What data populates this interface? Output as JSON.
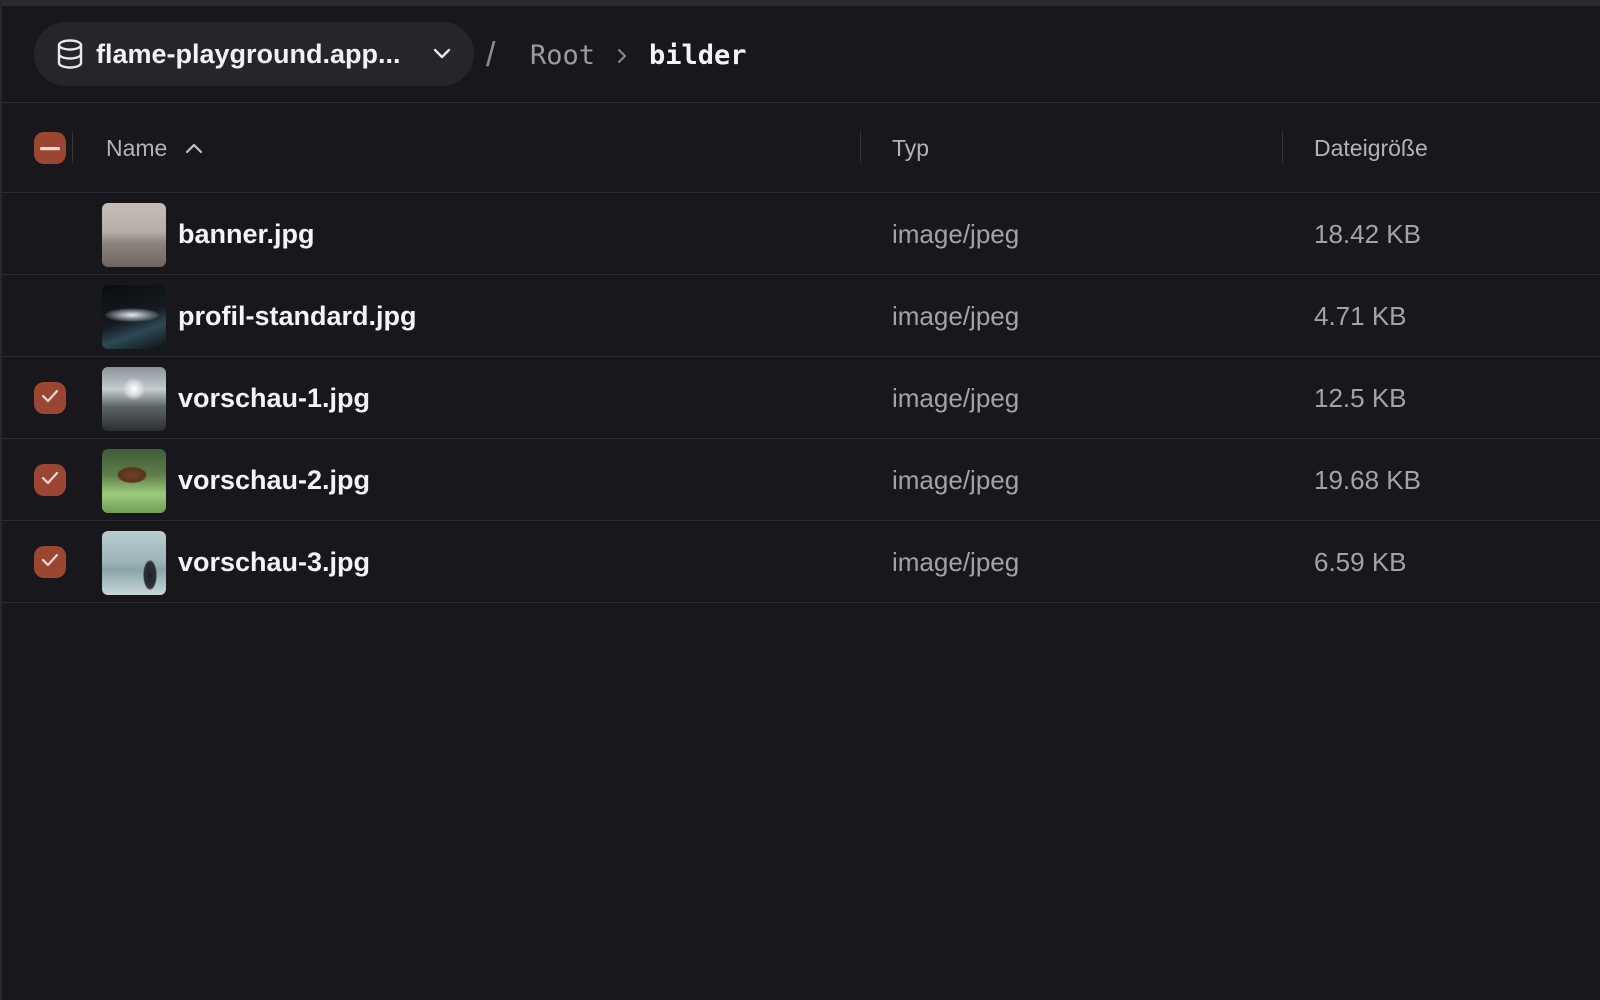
{
  "header": {
    "bucket_name": "flame-playground.app...",
    "separator": "/",
    "breadcrumb_root": "Root",
    "breadcrumb_current": "bilder"
  },
  "table": {
    "columns": {
      "name": "Name",
      "type": "Typ",
      "size": "Dateigröße"
    },
    "rows": [
      {
        "name": "banner.jpg",
        "type": "image/jpeg",
        "size": "18.42 KB",
        "selected": false
      },
      {
        "name": "profil-standard.jpg",
        "type": "image/jpeg",
        "size": "4.71 KB",
        "selected": false
      },
      {
        "name": "vorschau-1.jpg",
        "type": "image/jpeg",
        "size": "12.5 KB",
        "selected": true
      },
      {
        "name": "vorschau-2.jpg",
        "type": "image/jpeg",
        "size": "19.68 KB",
        "selected": true
      },
      {
        "name": "vorschau-3.jpg",
        "type": "image/jpeg",
        "size": "6.59 KB",
        "selected": true
      }
    ]
  },
  "colors": {
    "background": "#18181c",
    "accent": "#9a4632",
    "pill": "#25252b"
  },
  "icons": {
    "bucket": "database-icon",
    "dropdown": "chevron-down-icon",
    "breadcrumb": "chevron-right-icon",
    "sort": "chevron-up-icon",
    "select_all": "minus-icon",
    "row_selected": "check-icon"
  }
}
